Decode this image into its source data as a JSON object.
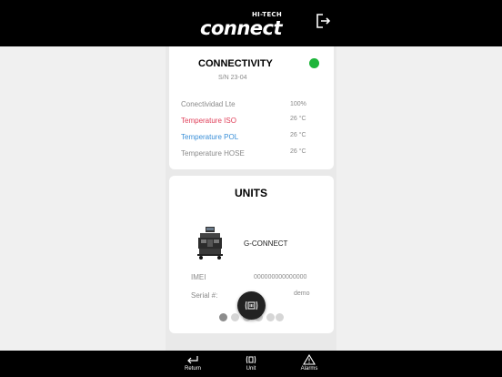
{
  "header": {
    "brand_small": "HI-TECH",
    "brand_large": "connect",
    "logout_icon": "logout-icon"
  },
  "connectivity": {
    "title": "CONNECTIVITY",
    "status_color": "#1db53a",
    "serial": "S/N 23-04",
    "rows": [
      {
        "label": "Conectividad Lte",
        "value": "100%",
        "color": "#8a8a8a"
      },
      {
        "label": "Temperature ISO",
        "value": "26 °C",
        "color": "#e0405a"
      },
      {
        "label": "Temperature POL",
        "value": "26 °C",
        "color": "#3a8fd8"
      },
      {
        "label": "Temperature HOSE",
        "value": "26 °C",
        "color": "#8a8a8a"
      }
    ]
  },
  "units": {
    "title": "UNITS",
    "unit_name": "G-CONNECT",
    "imei_label": "IMEI",
    "imei_value": "000000000000000",
    "serial_label": "Serial #:",
    "serial_value": "demo",
    "page_count": 6,
    "active_page": 1
  },
  "nav": {
    "items": [
      {
        "label": "Return",
        "icon": "return-icon"
      },
      {
        "label": "Unit",
        "icon": "unit-signal-icon"
      },
      {
        "label": "Alarms",
        "icon": "alarm-icon"
      }
    ]
  }
}
